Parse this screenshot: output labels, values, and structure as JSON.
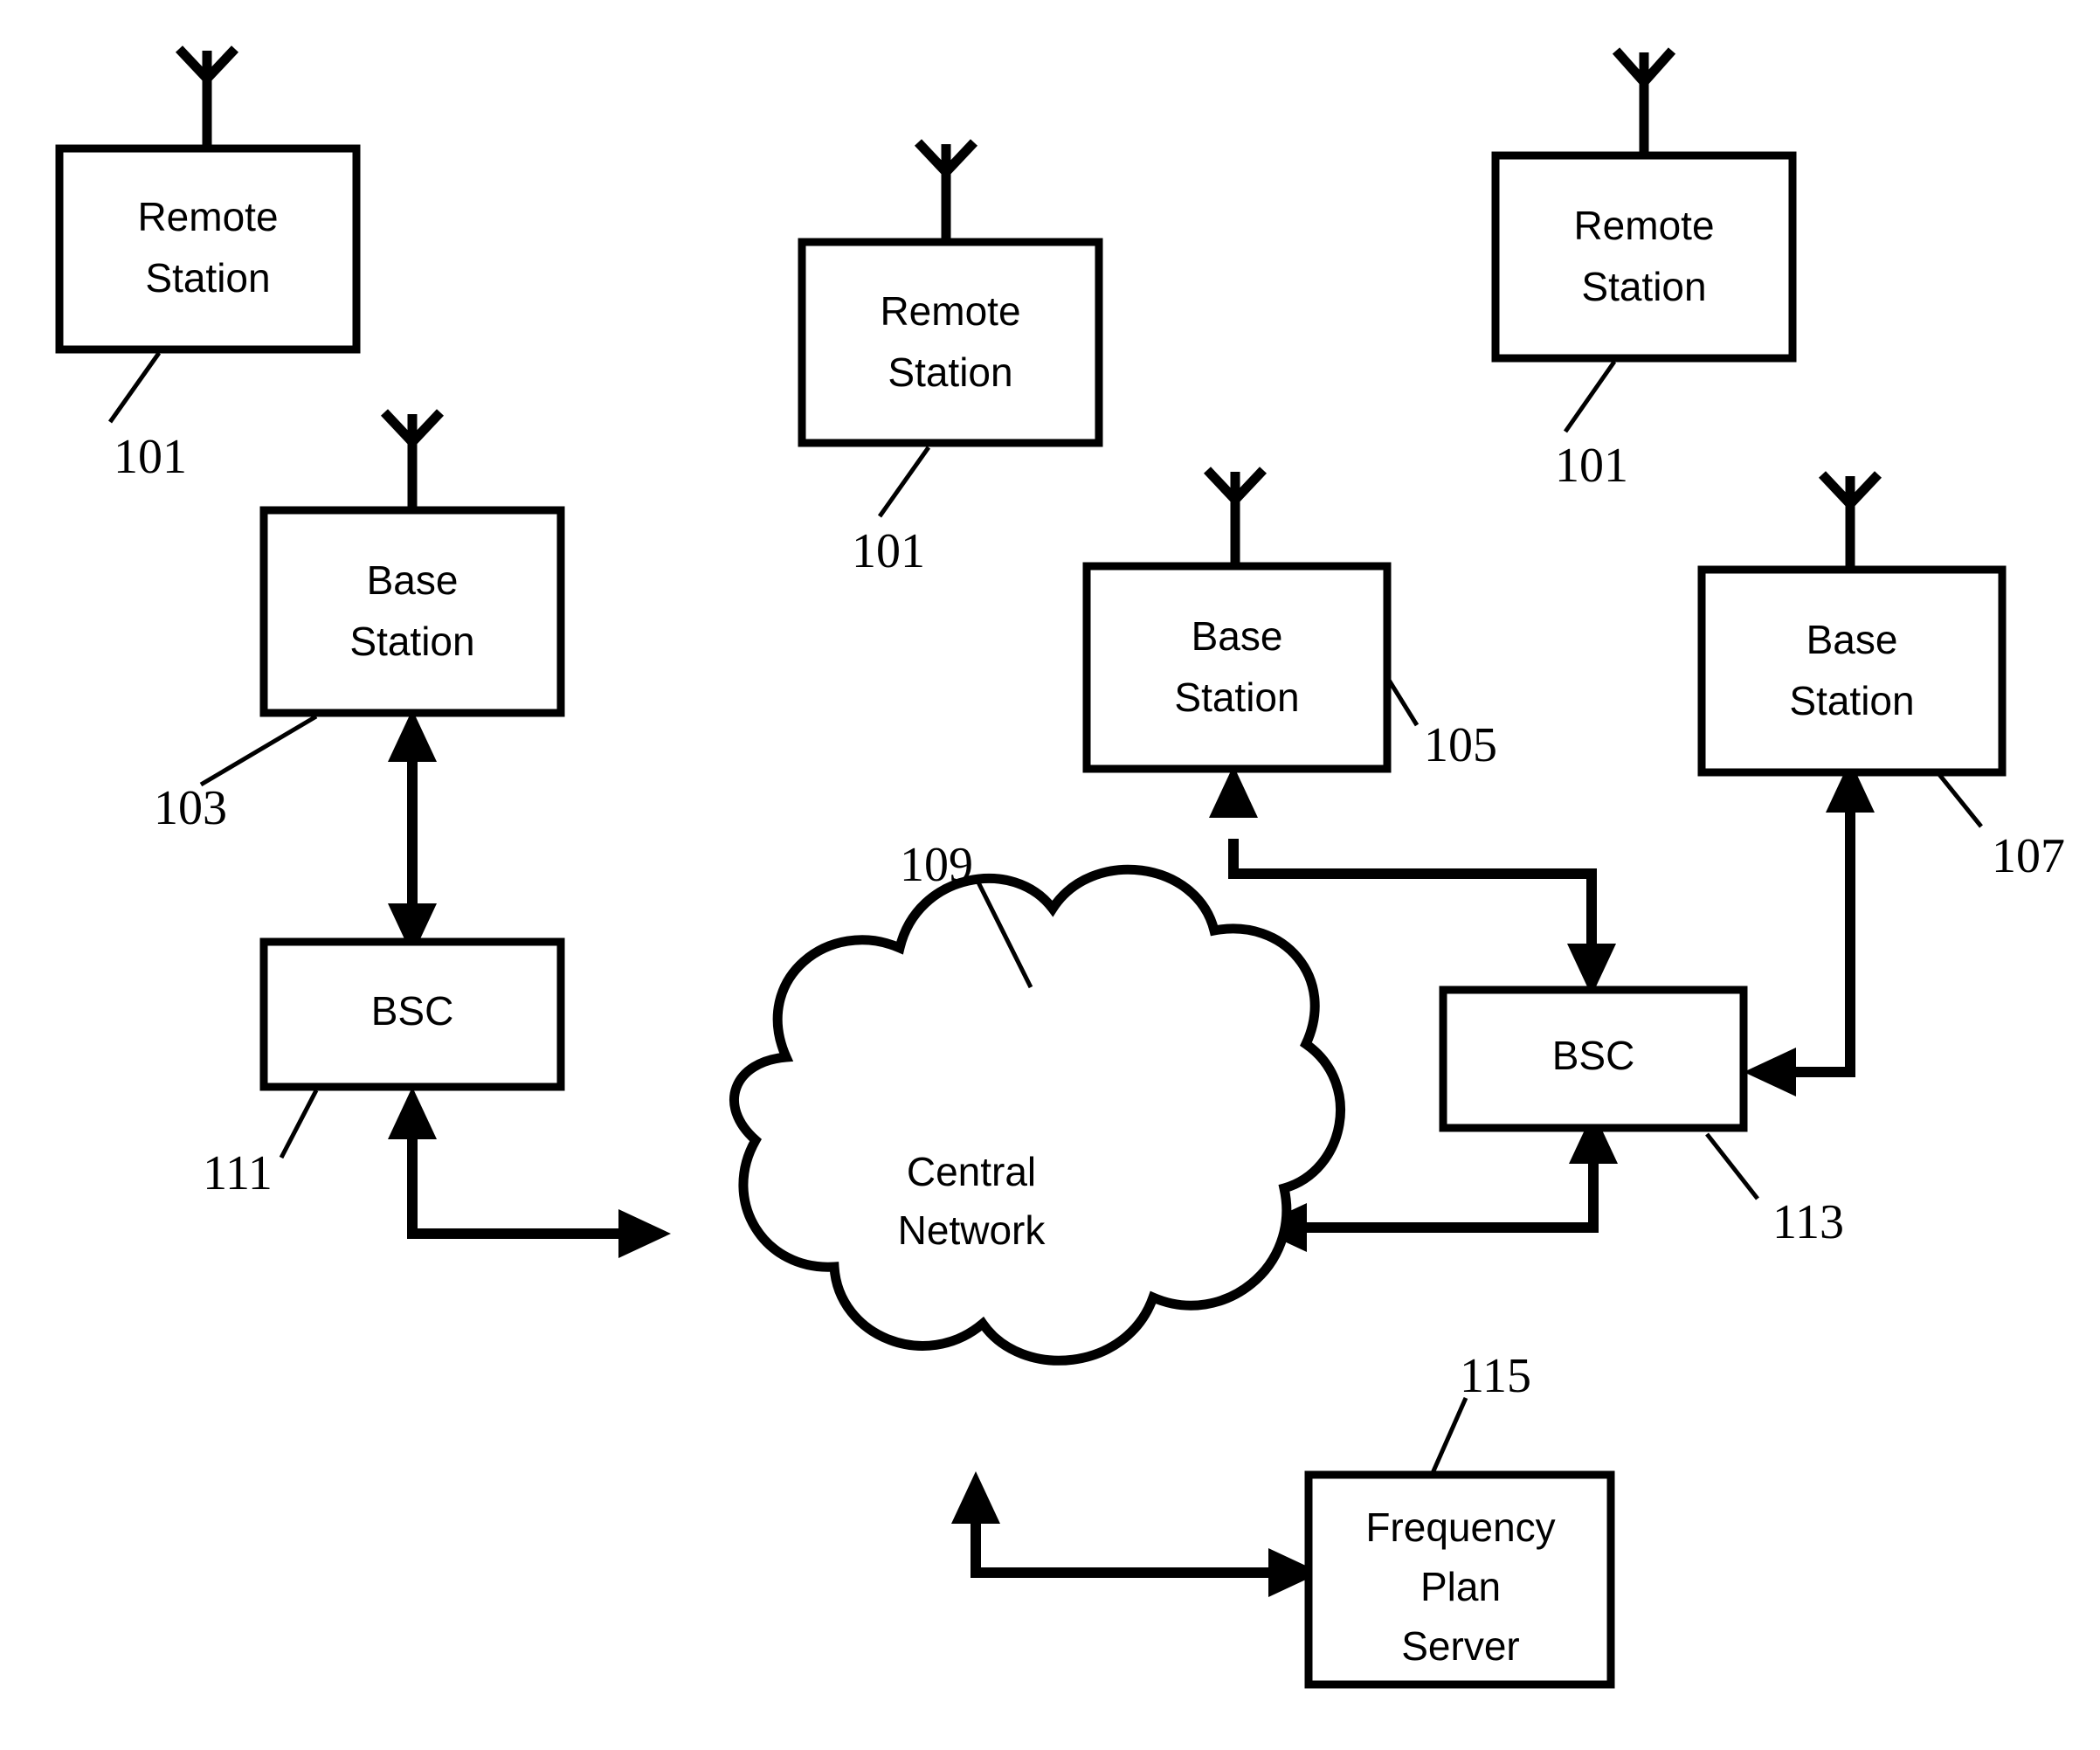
{
  "figure": {
    "type": "patent-network-diagram",
    "background_color": "#ffffff",
    "line_color": "#000000"
  },
  "nodes": {
    "remote_station_left": {
      "label_line1": "Remote",
      "label_line2": "Station",
      "ref": "101",
      "icon": "antenna-icon"
    },
    "remote_station_middle": {
      "label_line1": "Remote",
      "label_line2": "Station",
      "ref": "101",
      "icon": "antenna-icon"
    },
    "remote_station_right": {
      "label_line1": "Remote",
      "label_line2": "Station",
      "ref": "101",
      "icon": "antenna-icon"
    },
    "base_station_left": {
      "label_line1": "Base",
      "label_line2": "Station",
      "ref": "103",
      "icon": "antenna-icon"
    },
    "base_station_center": {
      "label_line1": "Base",
      "label_line2": "Station",
      "ref": "105",
      "icon": "antenna-icon"
    },
    "base_station_right": {
      "label_line1": "Base",
      "label_line2": "Station",
      "ref": "107",
      "icon": "antenna-icon"
    },
    "bsc_left": {
      "label": "BSC",
      "ref": "111"
    },
    "bsc_right": {
      "label": "BSC",
      "ref": "113"
    },
    "central_network": {
      "label_line1": "Central",
      "label_line2": "Network",
      "ref": "109",
      "icon": "cloud-icon"
    },
    "frequency_plan_server": {
      "label_line1": "Frequency",
      "label_line2": "Plan",
      "label_line3": "Server",
      "ref": "115"
    }
  },
  "connections": [
    {
      "from": "base_station_left",
      "to": "bsc_left",
      "style": "bidirectional-vertical"
    },
    {
      "from": "bsc_left",
      "to": "central_network",
      "style": "bidirectional-elbow"
    },
    {
      "from": "base_station_center",
      "to": "bsc_right",
      "style": "bidirectional-elbow"
    },
    {
      "from": "base_station_right",
      "to": "bsc_right",
      "style": "bidirectional-elbow"
    },
    {
      "from": "bsc_right",
      "to": "central_network",
      "style": "bidirectional-elbow"
    },
    {
      "from": "frequency_plan_server",
      "to": "central_network",
      "style": "bidirectional-elbow"
    }
  ]
}
